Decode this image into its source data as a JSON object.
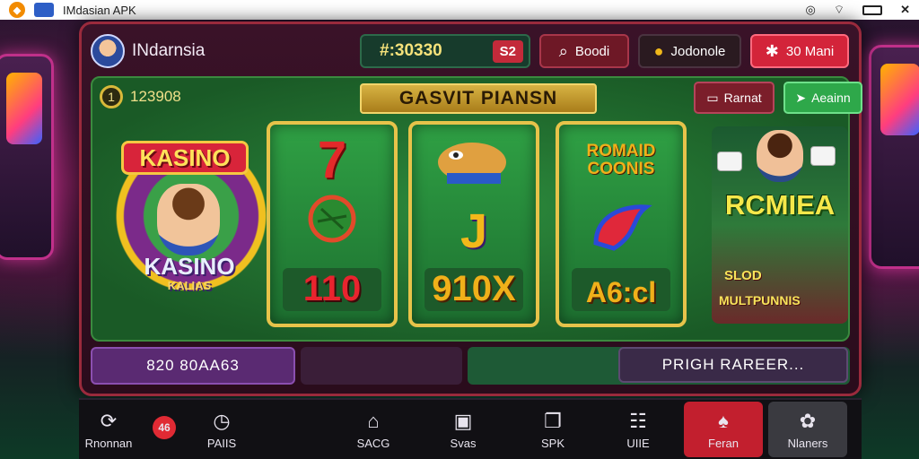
{
  "status_bar": {
    "app_title": "IMdasian APK",
    "icons": [
      "fox-logo-icon",
      "app-thumbnail-icon",
      "location-icon",
      "wifi-icon",
      "battery-icon",
      "close-icon"
    ]
  },
  "header": {
    "user_name": "INdarnsia",
    "balance": "#:30330",
    "balance_badge": "S2",
    "board_label": "Boodi",
    "donate_label": "Jodonole",
    "mani_label": "30 Mani"
  },
  "game": {
    "level_value": "123908",
    "title": "GASVIT PIANSN",
    "reset_label": "Rarnat",
    "again_label": "Aeainn",
    "logo_top": "KASINO",
    "logo_bottom": "KASINO",
    "logo_sub": "KALIAS",
    "reels": [
      {
        "top_symbol": "7",
        "bottom_value": "110"
      },
      {
        "top_symbol": "camel",
        "bottom_value": "910X"
      },
      {
        "top_symbol": "ROMAID COONIS",
        "bottom_value": "A6:cl"
      }
    ],
    "promo_title": "RCMIEA",
    "promo_sub1": "SLOD",
    "promo_sub2": "MULTPUNNIS"
  },
  "bottom_bar": {
    "left_text": "820 80AA63",
    "right_text": "PRIGH RAREER..."
  },
  "nav": [
    {
      "label": "Rnonnan",
      "icon": "refresh-icon"
    },
    {
      "label": "",
      "icon": "chip-icon",
      "badge": "46"
    },
    {
      "label": "PAIIS",
      "icon": "clock-icon"
    },
    {
      "label": "SACG",
      "icon": "home-icon"
    },
    {
      "label": "Svas",
      "icon": "game-icon"
    },
    {
      "label": "SPK",
      "icon": "cards-icon"
    },
    {
      "label": "UIIE",
      "icon": "grid-icon"
    },
    {
      "label": "Feran",
      "icon": "casino-icon"
    },
    {
      "label": "Nlaners",
      "icon": "gear-icon"
    }
  ],
  "colors": {
    "panel_border": "#9a2a3c",
    "accent_red": "#d3243a",
    "accent_green": "#2ea84a",
    "gold": "#e7c34a"
  }
}
